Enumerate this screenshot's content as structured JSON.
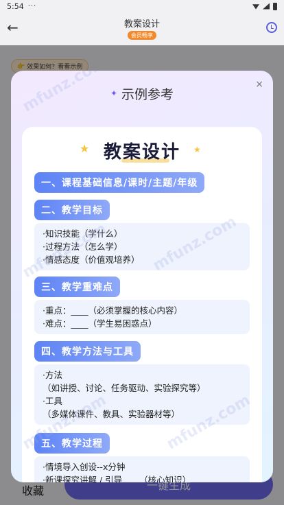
{
  "status": {
    "time": "5:54",
    "dots": "···"
  },
  "appbar": {
    "back_icon": "←",
    "title": "教案设计",
    "vip_badge": "会员畅享"
  },
  "example_chip": {
    "text": "效果如何？看看示例",
    "icon": "👉"
  },
  "bottom": {
    "collect": "收藏",
    "generate": "一键生成"
  },
  "modal": {
    "title": "示例参考",
    "close": "×",
    "doc_title": "教案设计",
    "sections": [
      {
        "heading": "一、课程基础信息/课时/主题/年级",
        "lines": []
      },
      {
        "heading": "二、教学目标",
        "lines": [
          "·知识技能（学什么）",
          "·过程方法（怎么学）",
          "·情感态度（价值观培养）"
        ]
      },
      {
        "heading": "三、教学重难点",
        "lines": [
          "·重点：____（必须掌握的核心内容）",
          "·难点：____（学生易困惑点）"
        ]
      },
      {
        "heading": "四、教学方法与工具",
        "lines": [
          "·方法",
          "（如讲授、讨论、任务驱动、实验探究等）",
          "·工具",
          "（多媒体课件、教具、实验器材等）"
        ]
      },
      {
        "heading": "五、教学过程",
        "lines": [
          "·情境导入创设--x分钟",
          "·新课探究讲解 / 引导____（核心知识）"
        ]
      }
    ]
  },
  "watermark_text": "mfunz.com"
}
